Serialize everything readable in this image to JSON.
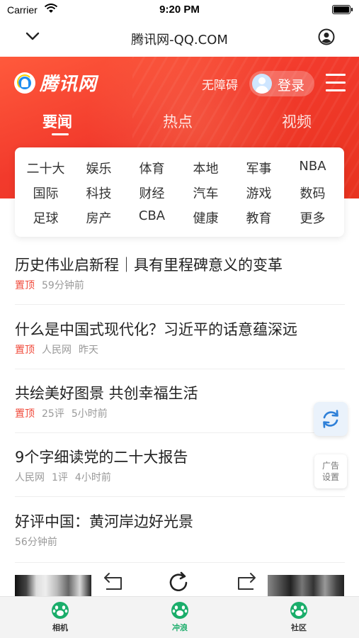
{
  "status_bar": {
    "carrier": "Carrier",
    "time": "9:20 PM"
  },
  "browser": {
    "url": "腾讯网-QQ.COM"
  },
  "header": {
    "logo_text": "腾讯网",
    "accessibility_label": "无障碍",
    "login_label": "登录",
    "tabs": [
      {
        "label": "要闻",
        "active": true
      },
      {
        "label": "热点",
        "active": false
      },
      {
        "label": "视频",
        "active": false
      }
    ]
  },
  "categories": [
    [
      "二十大",
      "娱乐",
      "体育",
      "本地",
      "军事",
      "NBA"
    ],
    [
      "国际",
      "科技",
      "财经",
      "汽车",
      "游戏",
      "数码"
    ],
    [
      "足球",
      "房产",
      "CBA",
      "健康",
      "教育",
      "更多"
    ]
  ],
  "news": [
    {
      "title": "历史伟业启新程｜具有里程碑意义的变革",
      "pinned": "置顶",
      "meta": [
        "59分钟前"
      ]
    },
    {
      "title": "什么是中国式现代化？习近平的话意蕴深远",
      "pinned": "置顶",
      "meta": [
        "人民网",
        "昨天"
      ]
    },
    {
      "title": "共绘美好图景 共创幸福生活",
      "pinned": "置顶",
      "meta": [
        "25评",
        "5小时前"
      ]
    },
    {
      "title": "9个字细读党的二十大报告",
      "pinned": "",
      "meta": [
        "人民网",
        "1评",
        "4小时前"
      ]
    },
    {
      "title": "好评中国：黄河岸边好光景",
      "pinned": "",
      "meta": [
        "56分钟前"
      ]
    }
  ],
  "ad_settings": {
    "line1": "广告",
    "line2": "设置"
  },
  "tabbar": [
    {
      "label": "相机",
      "icon": "paw-icon",
      "active": false
    },
    {
      "label": "冲浪",
      "icon": "paw-icon",
      "active": true
    },
    {
      "label": "社区",
      "icon": "paw-icon",
      "active": false
    }
  ],
  "colors": {
    "header_red": "#f23a2c",
    "pin_red": "#f04b3c",
    "accent_green": "#1aad6a",
    "refresh_blue": "#2f80d8"
  }
}
